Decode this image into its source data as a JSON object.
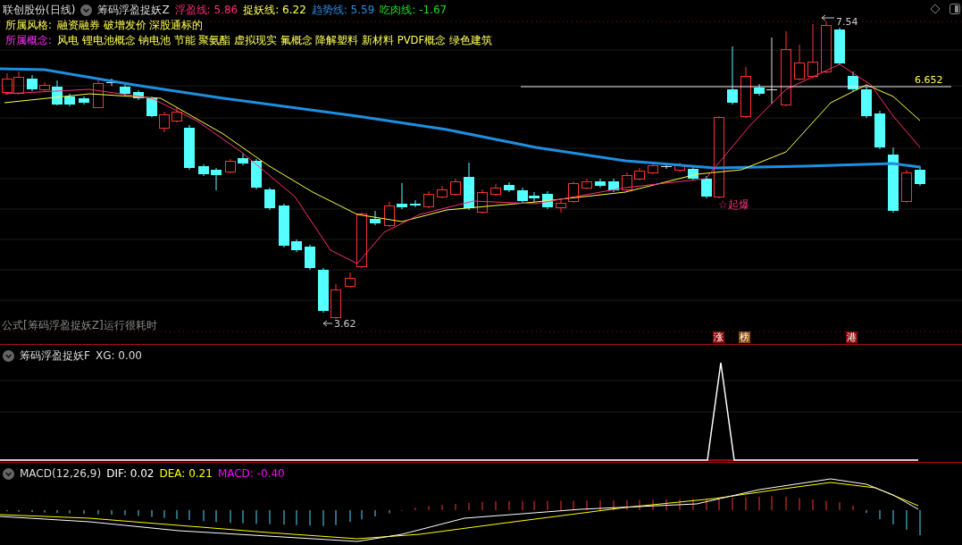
{
  "header": {
    "stock": "联创股份(日线)",
    "indicator": "筹码浮盈捉妖Z",
    "legend": [
      {
        "label": "浮盈线: 5.86",
        "color": "#ff2d7a"
      },
      {
        "label": "捉妖线: 6.22",
        "color": "#ffff55"
      },
      {
        "label": "趋势线: 5.59",
        "color": "#2a8ce0"
      },
      {
        "label": "吃肉线: -1.67",
        "color": "#22dd22"
      }
    ]
  },
  "style_line": {
    "label": "所属风格:",
    "value": "融资融券 破增发价 深股通标的"
  },
  "concept_line": {
    "label": "所属概念:",
    "value": "风电 锂电池概念 钠电池 节能 聚氨酯 虚拟现实 氟概念 降解塑料 新材料 PVDF概念 绿色建筑"
  },
  "annotations": {
    "high": "7.54",
    "low": "3.62",
    "level": "6.652",
    "signal": "☆起爆"
  },
  "notice": "公式[筹码浮盈捉妖Z]运行很耗时",
  "tags": [
    {
      "text": "涨",
      "color": "#8b0a0a"
    },
    {
      "text": "榜",
      "color": "#8b4a0a"
    },
    {
      "text": "港",
      "color": "#8b0a0a"
    }
  ],
  "pane2": {
    "indicator": "筹码浮盈捉妖F",
    "reading": "XG: 0.00"
  },
  "pane3": {
    "indicator": "MACD(12,26,9)",
    "legend": [
      {
        "label": "DIF: 0.02",
        "color": "#ffffff"
      },
      {
        "label": "DEA: 0.21",
        "color": "#ffff00"
      },
      {
        "label": "MACD: -0.40",
        "color": "#ff00ff"
      }
    ]
  }
}
